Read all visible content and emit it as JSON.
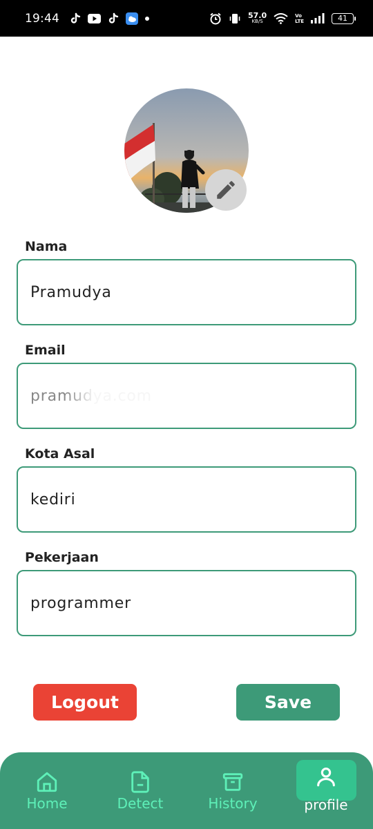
{
  "status_bar": {
    "time": "19:44",
    "net_speed_value": "57.0",
    "net_speed_unit": "KB/S",
    "volte_top": "Vo",
    "volte_bottom": "LTE",
    "battery": "41"
  },
  "form": {
    "name_label": "Nama",
    "name_value": "Pramudya",
    "email_label": "Email",
    "email_value": "pramudya.com",
    "city_label": "Kota Asal",
    "city_value": "kediri",
    "job_label": "Pekerjaan",
    "job_value": "programmer"
  },
  "actions": {
    "logout_label": "Logout",
    "save_label": "Save"
  },
  "nav": {
    "items": [
      {
        "label": "Home",
        "icon": "home-icon"
      },
      {
        "label": "Detect",
        "icon": "document-icon"
      },
      {
        "label": "History",
        "icon": "archive-icon"
      },
      {
        "label": "profile",
        "icon": "person-icon"
      }
    ],
    "active": "profile"
  },
  "colors": {
    "accent": "#3d9a78",
    "logout": "#ea4335",
    "nav_inactive": "#5ef0b8",
    "nav_active_bg": "#34c38f"
  }
}
